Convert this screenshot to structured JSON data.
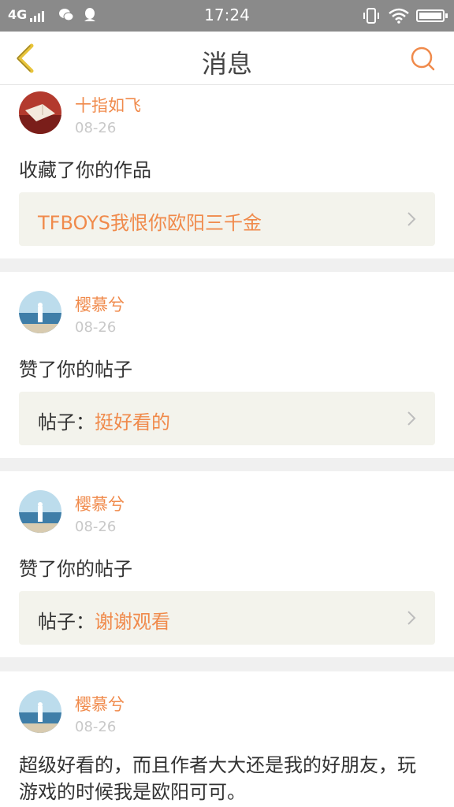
{
  "status_bar": {
    "network": "4G",
    "time": "17:24"
  },
  "header": {
    "title": "消息"
  },
  "colors": {
    "accent": "#f08a4b",
    "back_icon": "#e8c43a"
  },
  "messages": [
    {
      "user": "十指如飞",
      "date": "08-26",
      "action": "收藏了你的作品",
      "ref_prefix": "",
      "ref_title": "TFBOYS我恨你欧阳三千金"
    },
    {
      "user": "樱慕兮",
      "date": "08-26",
      "action": "赞了你的帖子",
      "ref_prefix": "帖子：",
      "ref_title": "挺好看的"
    },
    {
      "user": "樱慕兮",
      "date": "08-26",
      "action": "赞了你的帖子",
      "ref_prefix": "帖子：",
      "ref_title": "谢谢观看"
    },
    {
      "user": "樱慕兮",
      "date": "08-26",
      "comment": "超级好看的，而且作者大大还是我的好朋友，玩游戏的时候我是欧阳可可。"
    }
  ]
}
